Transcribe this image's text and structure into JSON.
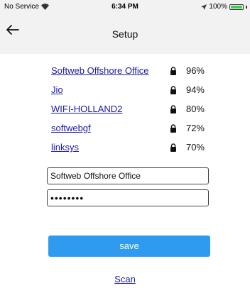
{
  "status_bar": {
    "carrier": "No Service",
    "time": "6:34 PM",
    "battery_text": "100%",
    "battery_level": 1.0
  },
  "nav": {
    "title": "Setup",
    "back_icon": "left-arrow-icon"
  },
  "wifi_networks": [
    {
      "name": "Softweb Offshore Office",
      "signal": "96%"
    },
    {
      "name": "Jio",
      "signal": "94%"
    },
    {
      "name": "WIFI-HOLLAND2",
      "signal": "80%"
    },
    {
      "name": "softwebgf",
      "signal": "72%"
    },
    {
      "name": "linksys",
      "signal": "70%"
    }
  ],
  "form": {
    "ssid_value": "Softweb Offshore Office",
    "password_value": "••••••••"
  },
  "actions": {
    "save_label": "save",
    "scan_label": "Scan"
  },
  "colors": {
    "accent": "#2e9bf0",
    "link": "#1a1aa6",
    "bar_background": "#f2f2f2"
  }
}
